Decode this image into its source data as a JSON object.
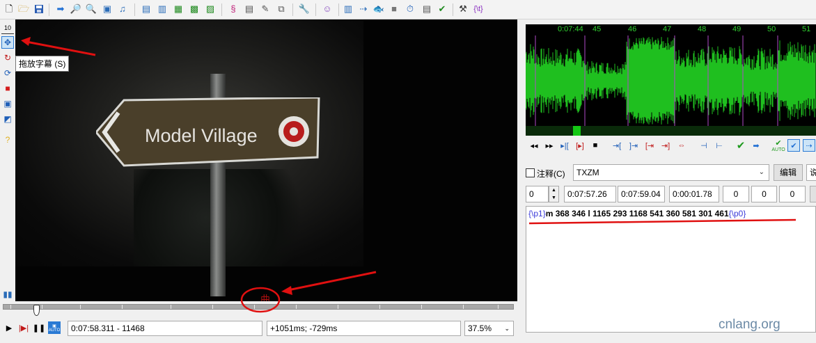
{
  "toolbar": {
    "icons": [
      "new-file-icon",
      "open-folder-icon",
      "save-icon",
      "jump-icon",
      "zoom-in-icon",
      "zoom-out-icon",
      "video-icon",
      "audio-icon",
      "style-icon",
      "attachments-icon",
      "fonts-icon",
      "grid-icon",
      "film-icon",
      "film-strip-icon",
      "script-icon",
      "properties-icon",
      "pen-icon",
      "copy-icon",
      "wrench-icon",
      "avatar-icon",
      "timing-icon",
      "shift-icon",
      "fish-icon",
      "record-icon",
      "clock-icon",
      "check-icon",
      "tools-icon",
      "karaoke-icon"
    ]
  },
  "left_toolbar": {
    "icons": [
      "standard-icon",
      "drag-icon",
      "rotate-z-icon",
      "rotate-xy-icon",
      "scale-icon",
      "clip-icon",
      "vector-clip-icon",
      "help-icon",
      "audio-toggle-icon"
    ],
    "top_label": "10"
  },
  "tooltip": "拖放字幕 (S)",
  "video": {
    "sign_text": "Model Village",
    "subtitle_char": "曲"
  },
  "bottom_bar": {
    "time_frame": "0:07:58.311 - 11468",
    "offset": "+1051ms; -729ms",
    "zoom": "37.5%",
    "auto_label": "AUTO"
  },
  "audio": {
    "timeline_labels": [
      "0:07:44",
      "45",
      "46",
      "47",
      "48",
      "49",
      "50",
      "51"
    ],
    "accent": "#1fbf1f"
  },
  "edit": {
    "comment_label": "注释(C)",
    "style": "TXZM",
    "edit_button": "编辑",
    "actor_placeholder": "说",
    "layer": "0",
    "start": "0:07:57.26",
    "end": "0:07:59.04",
    "duration": "0:00:01.78",
    "margin_l": "0",
    "margin_r": "0",
    "margin_v": "0",
    "text_prefix_tag": "{\\p1}",
    "text_body": "m 368 346 l 1165 293 1168 541 360 581 301 461",
    "text_suffix_tag": "{\\p0}"
  },
  "watermark": "cnlang.org"
}
